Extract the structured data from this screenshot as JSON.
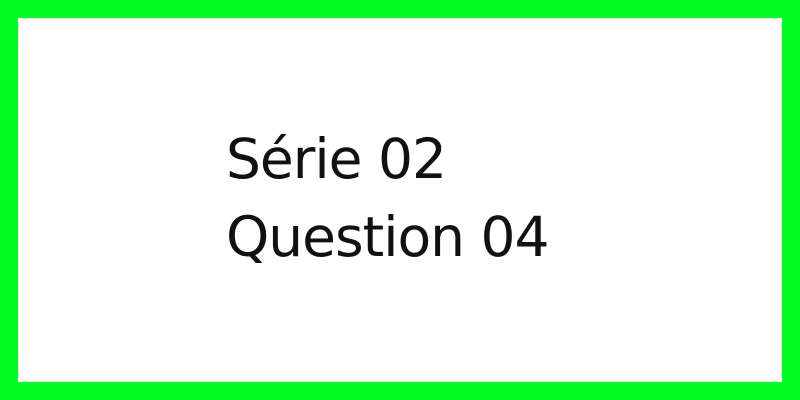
{
  "colors": {
    "frame": "#00ff1e",
    "background": "#ffffff",
    "text": "#111111"
  },
  "card": {
    "series": "Série 02",
    "question": "Question 04"
  }
}
